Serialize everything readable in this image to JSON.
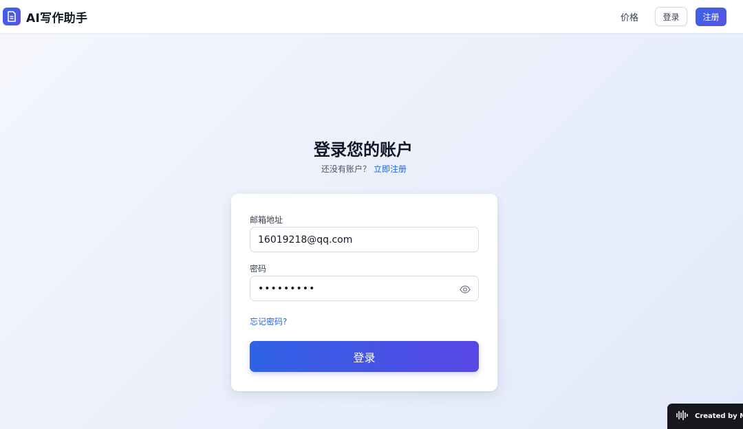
{
  "header": {
    "brand_name": "AI写作助手",
    "brand_icon": "document-icon",
    "nav_price": "价格",
    "login_label": "登录",
    "register_label": "注册"
  },
  "login": {
    "title": "登录您的账户",
    "no_account_text": "还没有账户？",
    "register_now_link": "立即注册",
    "email_label": "邮箱地址",
    "email_value": "16019218@qq.com",
    "password_label": "密码",
    "password_value": "•••••••••",
    "forgot_link": "忘记密码?",
    "submit_label": "登录"
  },
  "badge": {
    "text": "Created by Mir",
    "icon": "waveform-icon"
  },
  "colors": {
    "accent": "#3b64e8",
    "accent_end": "#5947e3",
    "link": "#2563eb"
  }
}
